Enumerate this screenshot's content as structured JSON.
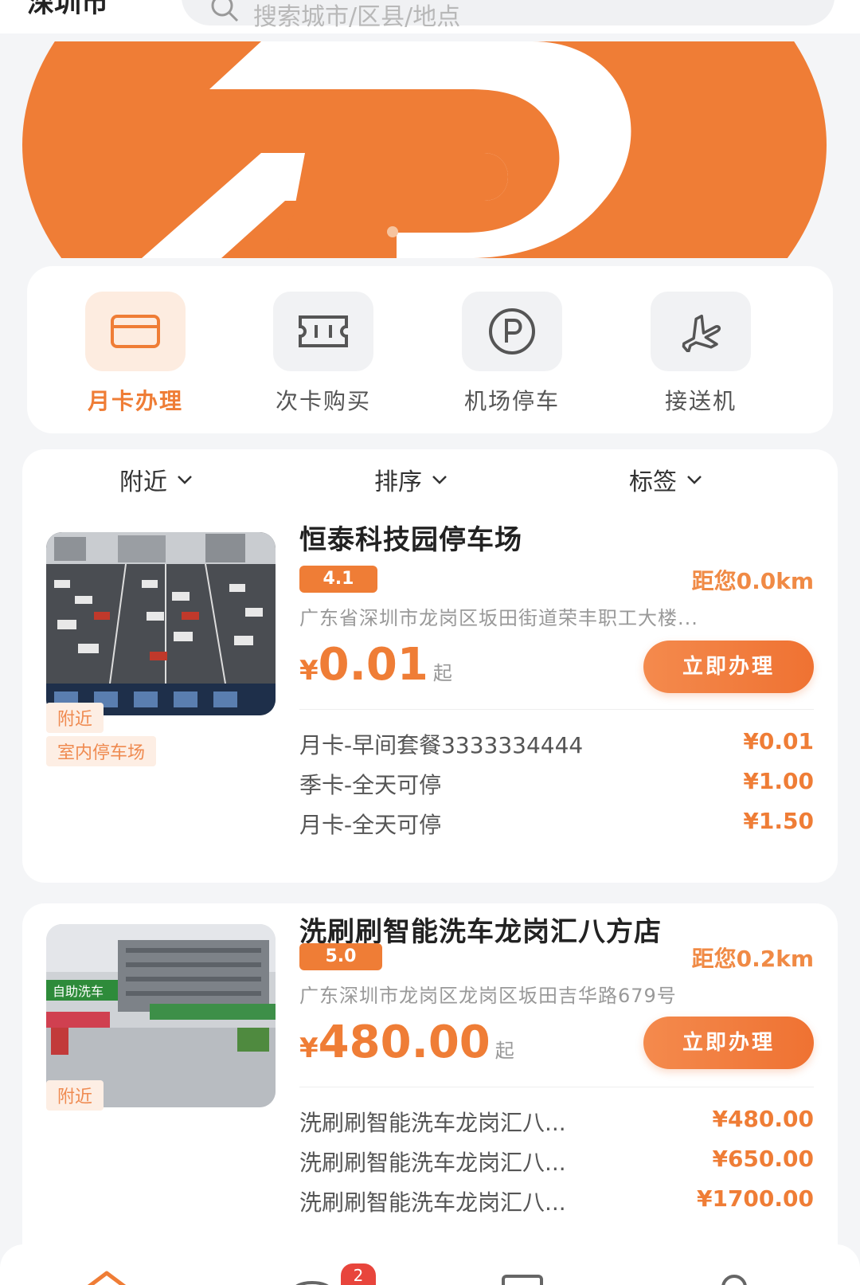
{
  "header": {
    "city": "深圳市",
    "search_placeholder": "搜索城市/区县/地点"
  },
  "banner": {
    "brand_color": "#ef7d36"
  },
  "menu": [
    {
      "label": "月卡办理",
      "icon": "card-icon",
      "active": true
    },
    {
      "label": "次卡购买",
      "icon": "ticket-icon",
      "active": false
    },
    {
      "label": "机场停车",
      "icon": "parking-icon",
      "active": false
    },
    {
      "label": "接送机",
      "icon": "airplane-icon",
      "active": false
    }
  ],
  "filters": [
    "附近",
    "排序",
    "标签"
  ],
  "lots": [
    {
      "name": "恒泰科技园停车场",
      "rating": "4.1",
      "distance": "距您0.0km",
      "address": "广东省深圳市龙岗区坂田街道荣丰职工大楼...",
      "currency": "¥",
      "price": "0.01",
      "price_suffix": "起",
      "button": "立即办理",
      "tags": [
        "附近",
        "室内停车场"
      ],
      "packages": [
        {
          "name": "月卡-早间套餐3333334444",
          "price": "¥0.01"
        },
        {
          "name": "季卡-全天可停",
          "price": "¥1.00"
        },
        {
          "name": "月卡-全天可停",
          "price": "¥1.50"
        }
      ]
    },
    {
      "name": "洗刷刷智能洗车龙岗汇八方店",
      "rating": "5.0",
      "distance": "距您0.2km",
      "address": "广东深圳市龙岗区龙岗区坂田吉华路679号",
      "currency": "¥",
      "price": "480.00",
      "price_suffix": "起",
      "button": "立即办理",
      "tags": [
        "附近"
      ],
      "packages": [
        {
          "name": "洗刷刷智能洗车龙岗汇八...",
          "price": "¥480.00"
        },
        {
          "name": "洗刷刷智能洗车龙岗汇八...",
          "price": "¥650.00"
        },
        {
          "name": "洗刷刷智能洗车龙岗汇八...",
          "price": "¥1700.00"
        }
      ]
    }
  ],
  "bottom_nav": {
    "badge": "2",
    "icons": [
      "home-icon",
      "message-icon",
      "card-icon",
      "profile-icon"
    ]
  }
}
